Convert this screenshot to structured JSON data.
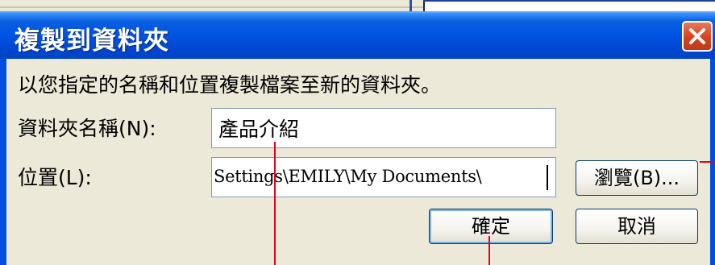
{
  "dialog": {
    "title": "複製到資料夾",
    "description": "以您指定的名稱和位置複製檔案至新的資料夾。",
    "folder_name_label": "資料夾名稱(N):",
    "folder_name_value": "產品介紹",
    "location_label": "位置(L):",
    "location_value": "Settings\\EMILY\\My Documents\\",
    "browse_label": "瀏覽(B)...",
    "ok_label": "確定",
    "cancel_label": "取消"
  },
  "colors": {
    "title_bar": "#0054e3",
    "dialog_bg": "#ece9d8",
    "close_button": "#d6421e",
    "callout_line": "#e8001c"
  },
  "icons": {
    "close": "close-x-icon"
  }
}
